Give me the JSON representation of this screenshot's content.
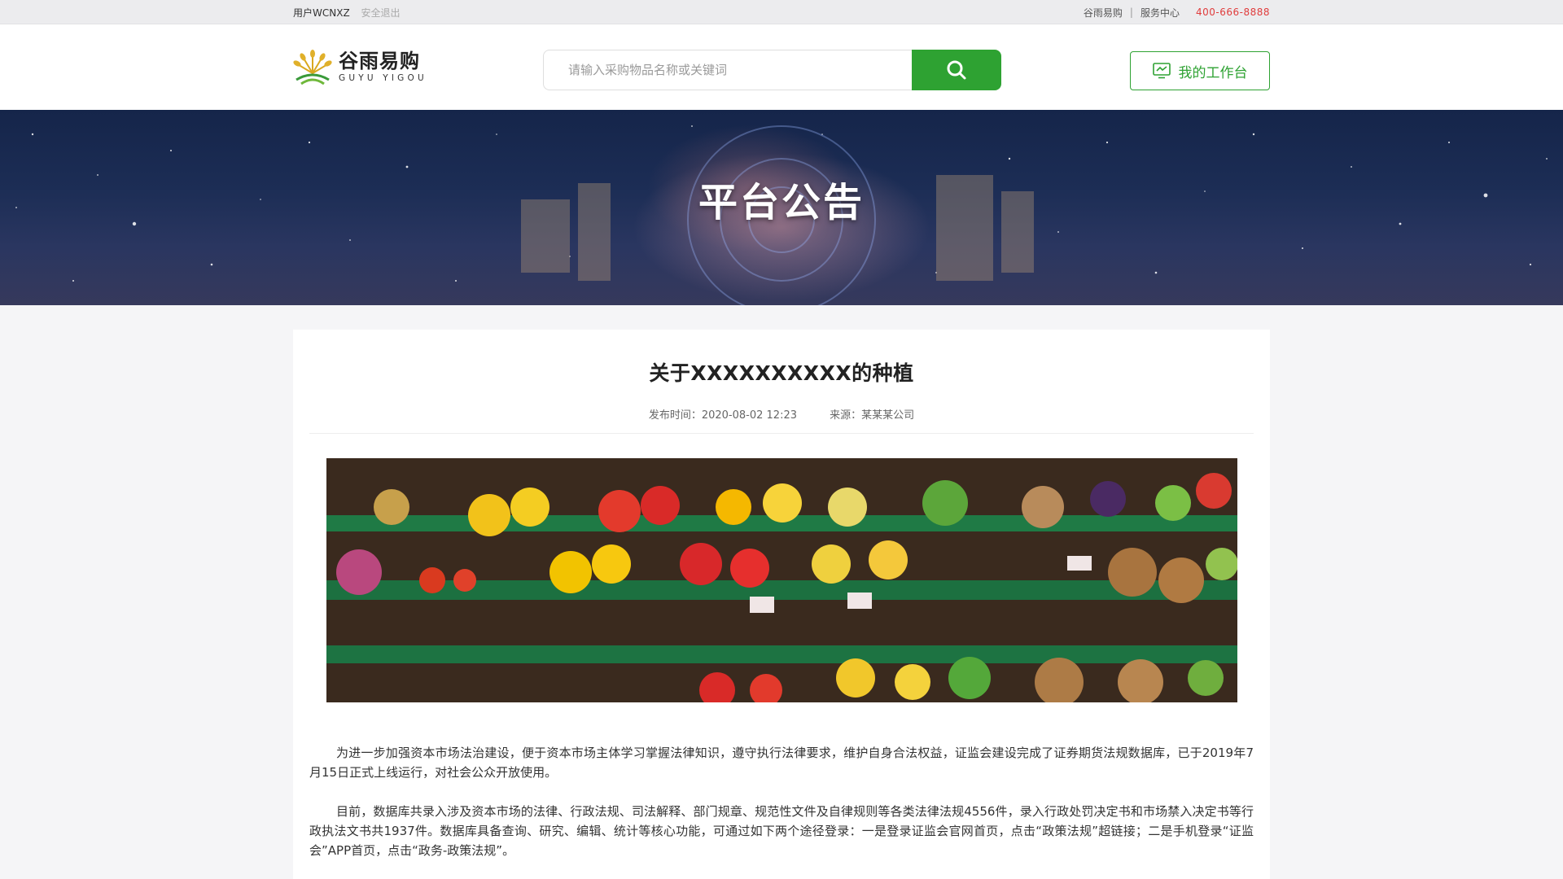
{
  "topbar": {
    "user_label": "用户WCNXZ",
    "logout_label": "安全退出",
    "brand_link": "谷雨易购",
    "divider": "|",
    "service_link": "服务中心",
    "phone": "400-666-8888"
  },
  "header": {
    "logo_cn": "谷雨易购",
    "logo_en": "GUYU YIGOU",
    "search_placeholder": "请输入采购物品名称或关键词",
    "search_icon": "search-icon",
    "workbench_label": "我的工作台",
    "workbench_icon": "monitor-icon",
    "accent_color": "#2ea232"
  },
  "banner": {
    "title": "平台公告"
  },
  "article": {
    "title": "关于XXXXXXXXXX的种植",
    "publish_time": "发布时间：2020-08-02 12:23",
    "source": "来源：某某某公司",
    "paragraphs": [
      "为进一步加强资本市场法治建设，便于资本市场主体学习掌握法律知识，遵守执行法律要求，维护自身合法权益，证监会建设完成了证券期货法规数据库，已于2019年7月15日正式上线运行，对社会公众开放使用。",
      "目前，数据库共录入涉及资本市场的法律、行政法规、司法解释、部门规章、规范性文件及自律规则等各类法律法规4556件，录入行政处罚决定书和市场禁入决定书等行政执法文书共1937件。数据库具备查询、研究、编辑、统计等核心功能，可通过如下两个途径登录：一是登录证监会官网首页，点击“政策法规”超链接；二是手机登录“证监会”APP首页，点击“政务-政策法规”。"
    ]
  }
}
